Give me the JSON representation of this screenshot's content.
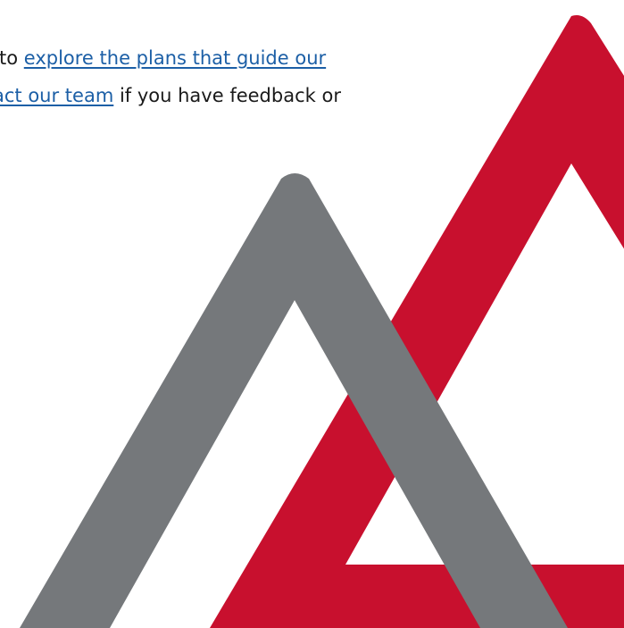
{
  "paragraph": {
    "line1_prefix": "to ",
    "line1_link": "explore the plans that guide our ",
    "line2_link": "act our team",
    "line2_suffix": " if you have feedback or"
  },
  "colors": {
    "link": "#1c5fa6",
    "text": "#1a1a1a",
    "red_mountain": "#c8102e",
    "gray_mountain": "#75787b",
    "background": "#ffffff"
  },
  "icons": {
    "decoration": "mountain-logo-graphic"
  }
}
